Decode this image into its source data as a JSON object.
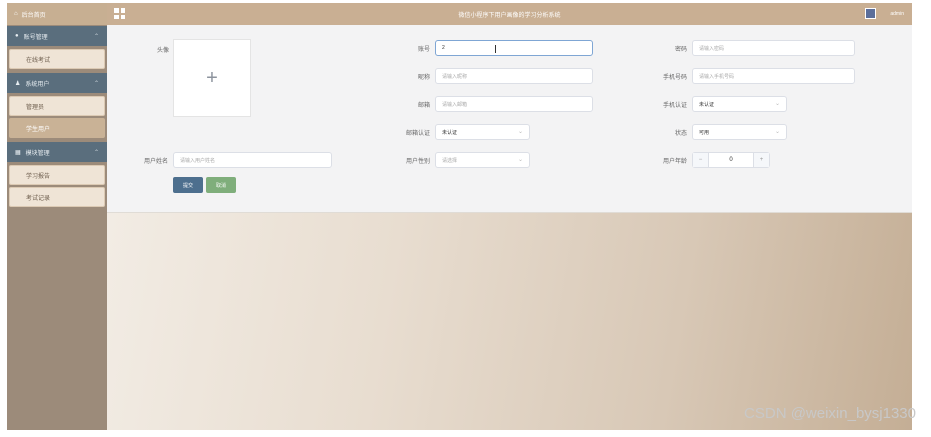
{
  "sidebar": {
    "home": "后台首页",
    "groups": [
      {
        "label": "账号管理",
        "items": [
          {
            "label": "在线考试",
            "active": false
          }
        ]
      },
      {
        "label": "系统用户",
        "items": [
          {
            "label": "管理员",
            "active": false
          },
          {
            "label": "学生用户",
            "active": true
          }
        ]
      },
      {
        "label": "模块管理",
        "items": [
          {
            "label": "学习报告",
            "active": false
          },
          {
            "label": "考试记录",
            "active": false
          }
        ]
      }
    ]
  },
  "header": {
    "title": "微信小程序下用户画像的学习分析系统",
    "user": "admin"
  },
  "form": {
    "avatar_label": "头像",
    "account": {
      "label": "账号",
      "value": "2"
    },
    "password": {
      "label": "密码",
      "placeholder": "请输入密码"
    },
    "nickname": {
      "label": "昵称",
      "placeholder": "请输入昵称"
    },
    "phone": {
      "label": "手机号码",
      "placeholder": "请输入手机号码"
    },
    "email": {
      "label": "邮箱",
      "placeholder": "请输入邮箱"
    },
    "phone_verify": {
      "label": "手机认证",
      "value": "未认证"
    },
    "email_verify": {
      "label": "邮箱认证",
      "value": "未认证"
    },
    "status": {
      "label": "状态",
      "value": "可用"
    },
    "real_name": {
      "label": "用户姓名",
      "placeholder": "请输入用户姓名"
    },
    "gender": {
      "label": "用户性别",
      "placeholder": "请选择"
    },
    "age": {
      "label": "用户年龄",
      "value": "0",
      "minus": "−",
      "plus": "+"
    },
    "submit": "提交",
    "cancel": "取消"
  },
  "icons": {
    "home": "home-icon",
    "grid": "grid-icon"
  },
  "colors": {
    "sidebar_group": "#5a6e7d",
    "header": "#c9af93",
    "submit": "#4d6f8e",
    "cancel": "#7fae7b"
  },
  "watermark": "CSDN @weixin_bysj1330"
}
